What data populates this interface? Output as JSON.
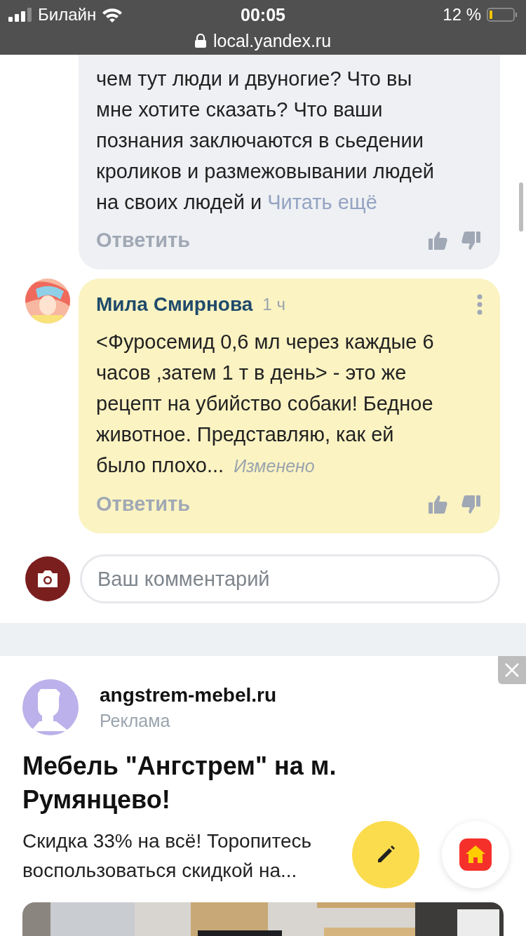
{
  "status_bar": {
    "carrier": "Билайн",
    "time": "00:05",
    "battery": "12 %",
    "url": "local.yandex.ru"
  },
  "comments": [
    {
      "text": "чем тут люди и двуногие? Что вы\nмне хотите сказать? Что ваши\nпознания заключаются в сьедении\nкроликов и размежовывании людей\nна своих людей и",
      "more_link": "Читать ещё",
      "reply": "Ответить",
      "highlighted": false
    },
    {
      "author": "Мила Смирнова",
      "time": "1 ч",
      "text": "<Фуросемид 0,6 мл через каждые 6\nчасов ,затем 1 т в день>  - это же\nрецепт на убийство собаки! Бедное\nживотное. Представляю, как ей\nбыло плохо...",
      "edited": "Изменено",
      "reply": "Ответить",
      "highlighted": true
    }
  ],
  "comment_input": {
    "placeholder": "Ваш комментарий"
  },
  "ad": {
    "domain": "angstrem-mebel.ru",
    "label": "Реклама",
    "title": "Мебель \"Ангстрем\" на м.\nРумянцево!",
    "description": "Скидка 33% на всё! Торопитесь\nвоспользоваться скидкой на..."
  }
}
